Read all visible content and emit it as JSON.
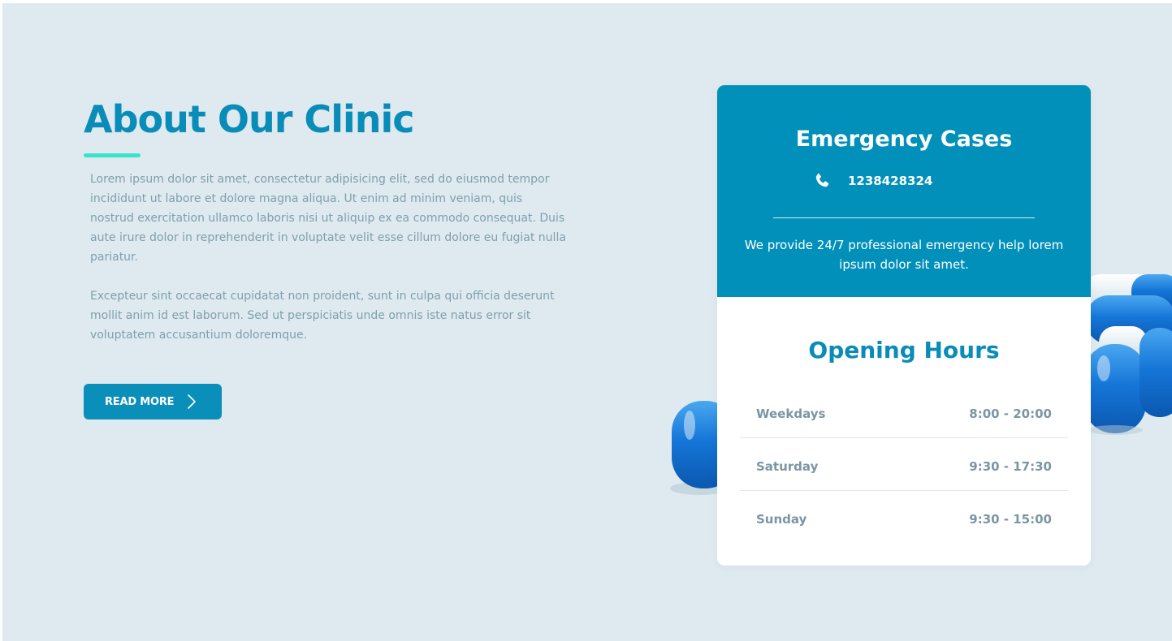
{
  "about": {
    "title": "About Our Clinic",
    "paragraph_1": "Lorem ipsum dolor sit amet, consectetur adipisicing elit, sed do eiusmod tempor incididunt ut labore et dolore magna aliqua. Ut enim ad minim veniam, quis nostrud exercitation ullamco laboris nisi ut aliquip ex ea commodo consequat. Duis aute irure dolor in reprehenderit in voluptate velit esse cillum dolore eu fugiat nulla pariatur.",
    "paragraph_2": "Excepteur sint occaecat cupidatat non proident, sunt in culpa qui officia deserunt mollit anim id est laborum. Sed ut perspiciatis unde omnis iste natus error sit voluptatem accusantium doloremque.",
    "button_label": "READ MORE",
    "button_icon": "chevron-right-icon"
  },
  "emergency": {
    "title": "Emergency Cases",
    "phone_icon": "phone-icon",
    "phone": "1238428324",
    "description": "We provide 24/7 professional emergency help lorem ipsum dolor sit amet."
  },
  "hours": {
    "title": "Opening Hours",
    "rows": [
      {
        "day": "Weekdays",
        "time": "8:00 - 20:00"
      },
      {
        "day": "Saturday",
        "time": "9:30 - 17:30"
      },
      {
        "day": "Sunday",
        "time": "9:30 - 15:00"
      }
    ]
  },
  "colors": {
    "background": "#deeaef",
    "primary": "#0190ba",
    "heading": "#0a8cb8",
    "accent": "#3be3c9",
    "body_text": "#7f9fad",
    "card": "#ffffff",
    "pill_blue": "#1173d0"
  }
}
